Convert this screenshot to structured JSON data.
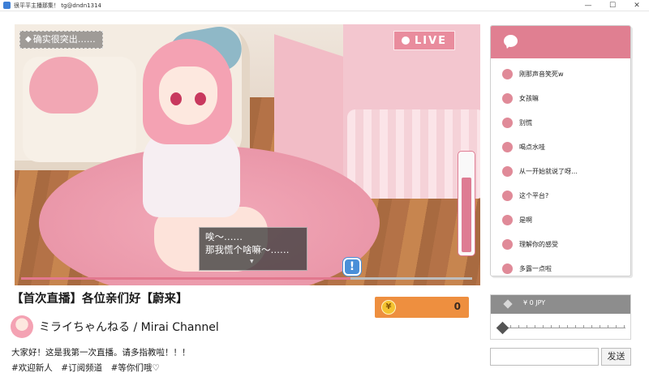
{
  "window": {
    "title": "很平平主播那集！ tg@dndn1314",
    "controls": {
      "minimize": "—",
      "maximize": "☐",
      "close": "✕"
    }
  },
  "stage": {
    "badge_text": "确实很突出……",
    "live_label": "LIVE",
    "level_fraction": 0.77,
    "progress_fraction": 0.73,
    "dialogue_lines": [
      "唉～……",
      "那我慌个啥嘛～……"
    ],
    "alert_icon": "exclamation-icon"
  },
  "stream": {
    "title": "【首次直播】各位亲们好【蔚来】",
    "channel": "ミライちゃんねる / Mirai Channel",
    "description": "大家好！这是我第一次直播。请多指教啦！！！",
    "tags": "#欢迎新人　#订阅频道　#等你们哦♡"
  },
  "coins": {
    "symbol": "¥",
    "value": "0"
  },
  "chat": {
    "header_icon": "chat-bubble-icon",
    "messages": [
      "刚那声音笑死w",
      "女孩嘛",
      "别慌",
      "喝点水哇",
      "从一开始就说了呀…",
      "这个平台?",
      "是啊",
      "理解你的感受",
      "多露一点啦"
    ]
  },
  "tip": {
    "amount_label": "¥ 0 JPY",
    "slider_fraction": 0
  },
  "composer": {
    "placeholder": "",
    "send_label": "发送"
  },
  "colors": {
    "accent_pink": "#e07f91",
    "coin_orange": "#ee8f3f",
    "alert_blue": "#4a8fd8"
  }
}
